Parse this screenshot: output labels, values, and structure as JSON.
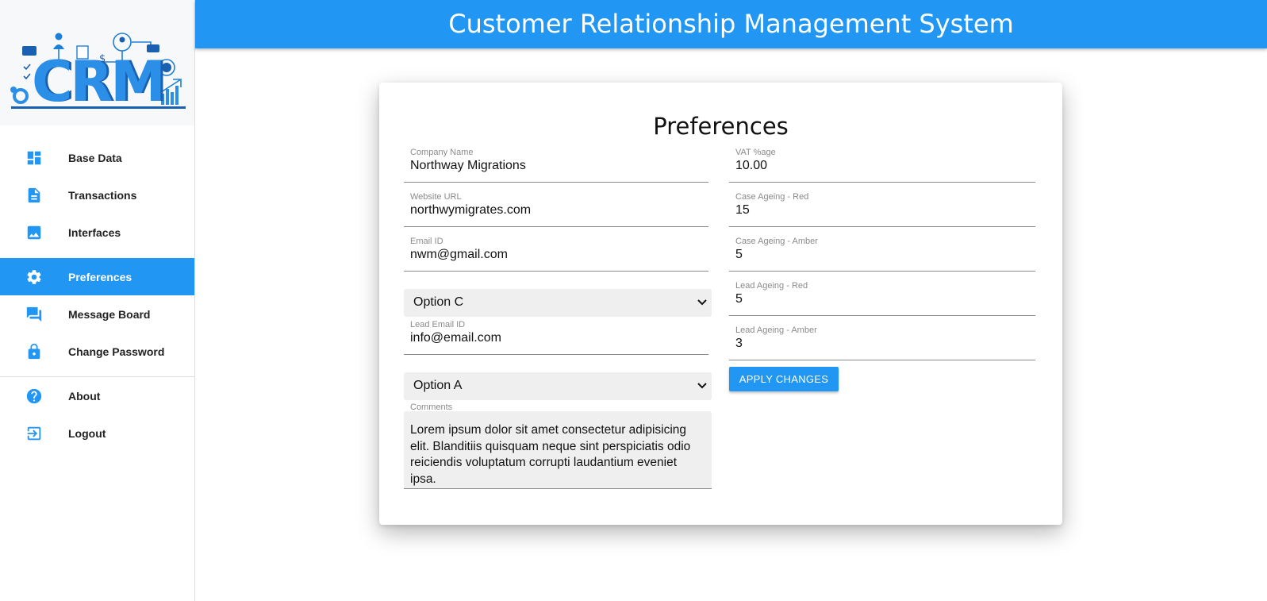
{
  "app": {
    "header_title": "Customer Relationship Management System",
    "logo_text": "CRM",
    "accent_color": "#2196f3"
  },
  "sidebar": {
    "items": [
      {
        "label": "Base Data",
        "icon": "dashboard-icon",
        "active": false
      },
      {
        "label": "Transactions",
        "icon": "document-icon",
        "active": false
      },
      {
        "label": "Interfaces",
        "icon": "image-icon",
        "active": false
      },
      {
        "label": "Preferences",
        "icon": "gear-icon",
        "active": true
      },
      {
        "label": "Message Board",
        "icon": "chat-icon",
        "active": false
      },
      {
        "label": "Change Password",
        "icon": "lock-icon",
        "active": false
      }
    ],
    "bottom_items": [
      {
        "label": "About",
        "icon": "help-icon"
      },
      {
        "label": "Logout",
        "icon": "logout-icon"
      }
    ]
  },
  "form": {
    "title": "Preferences",
    "company_name": {
      "label": "Company Name",
      "value": "Northway Migrations"
    },
    "website_url": {
      "label": "Website URL",
      "value": "northwymigrates.com"
    },
    "email_id": {
      "label": "Email ID",
      "value": "nwm@gmail.com"
    },
    "select_1": {
      "value": "Option C"
    },
    "lead_email_id": {
      "label": "Lead Email ID",
      "value": "info@email.com"
    },
    "select_2": {
      "value": "Option A"
    },
    "comments": {
      "label": "Comments",
      "value": "Lorem ipsum dolor sit amet consectetur adipisicing elit. Blanditiis quisquam neque sint perspiciatis odio reiciendis voluptatum corrupti laudantium eveniet ipsa."
    },
    "vat": {
      "label": "VAT %age",
      "value": "10.00"
    },
    "case_ageing_red": {
      "label": "Case Ageing - Red",
      "value": "15"
    },
    "case_ageing_amber": {
      "label": "Case Ageing - Amber",
      "value": "5"
    },
    "lead_ageing_red": {
      "label": "Lead Ageing - Red",
      "value": "5"
    },
    "lead_ageing_amber": {
      "label": "Lead Ageing - Amber",
      "value": "3"
    },
    "apply_button": "APPLY CHANGES"
  }
}
